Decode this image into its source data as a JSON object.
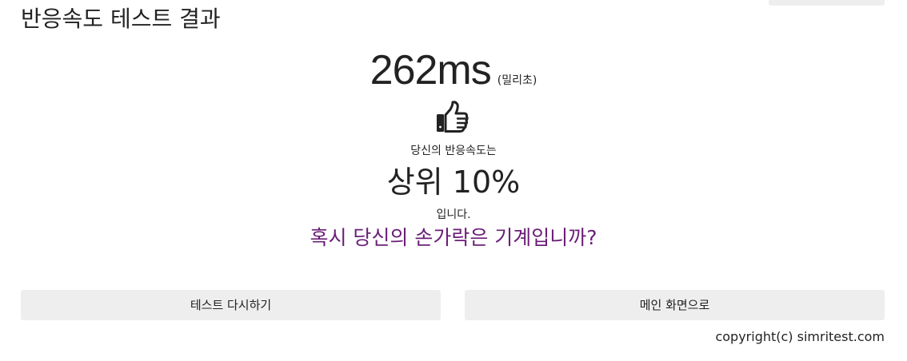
{
  "header": {
    "title": "반응속도 테스트 결과"
  },
  "result": {
    "time_value": "262ms",
    "time_unit": "(밀리초)",
    "result_icon": "thumbs-up-icon",
    "intro_text": "당신의 반응속도는",
    "rank_text": "상위 10%",
    "outro_text": "입니다.",
    "comment": "혹시 당신의 손가락은 기계입니까?"
  },
  "actions": {
    "retry_label": "테스트 다시하기",
    "main_label": "메인 화면으로"
  },
  "footer": {
    "copyright": "copyright(c) simritest.com"
  },
  "colors": {
    "accent_text": "#6b1e78",
    "button_bg": "#eeeeee",
    "text": "#222222"
  }
}
